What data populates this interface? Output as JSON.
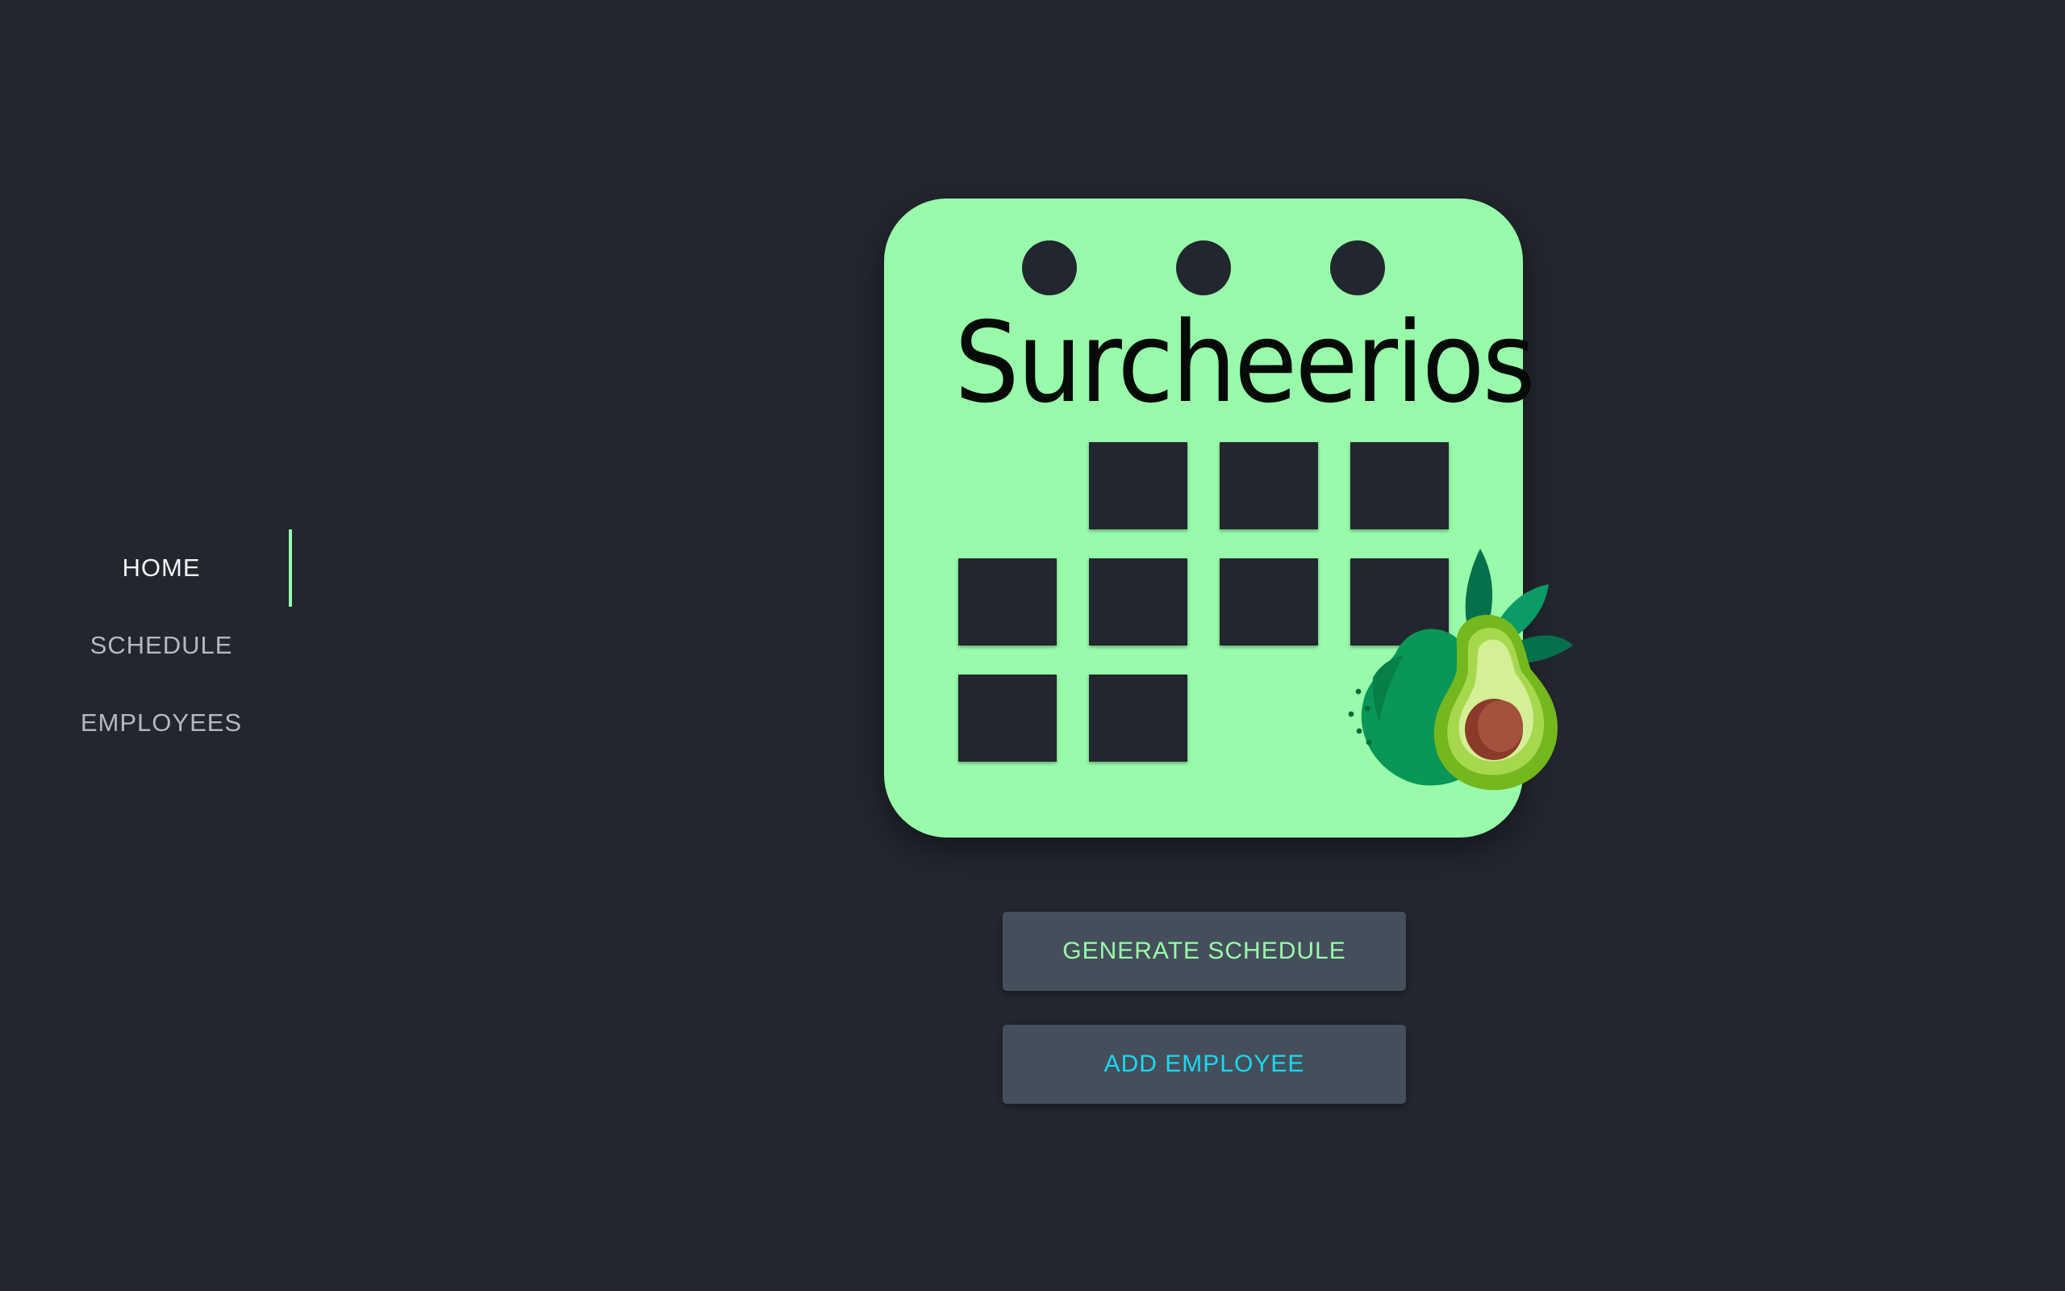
{
  "sidebar": {
    "items": [
      {
        "label": "HOME",
        "active": true
      },
      {
        "label": "SCHEDULE",
        "active": false
      },
      {
        "label": "EMPLOYEES",
        "active": false
      }
    ],
    "active_indicator_color": "#98fbaa"
  },
  "hero": {
    "logo_text": "Surcheerios",
    "calendar_color": "#98fbaa",
    "icon": "avocado-icon"
  },
  "actions": {
    "generate_label": "GENERATE SCHEDULE",
    "generate_color": "#98fbaa",
    "add_label": "ADD EMPLOYEE",
    "add_color": "#19d8f2"
  },
  "theme": {
    "background": "#22262e",
    "button_background": "#454f5b"
  }
}
